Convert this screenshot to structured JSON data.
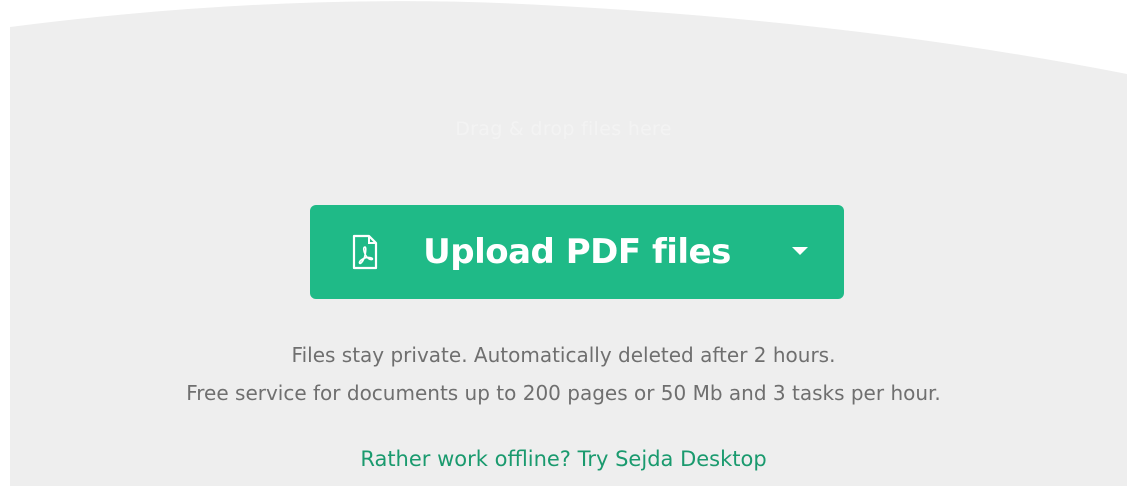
{
  "drop_zone": {
    "hint": "Drag & drop files here",
    "background_color": "#eeeeee"
  },
  "upload": {
    "label": "Upload PDF files",
    "icon": "pdf-file-icon",
    "dropdown_icon": "caret-down-icon",
    "color": "#1fba87"
  },
  "info": {
    "line1": "Files stay private. Automatically deleted after 2 hours.",
    "line2": "Free service for documents up to 200 pages or 50 Mb and 3 tasks per hour."
  },
  "desktop_link": {
    "label": "Rather work offline? Try Sejda Desktop",
    "color": "#1a9a6e"
  }
}
